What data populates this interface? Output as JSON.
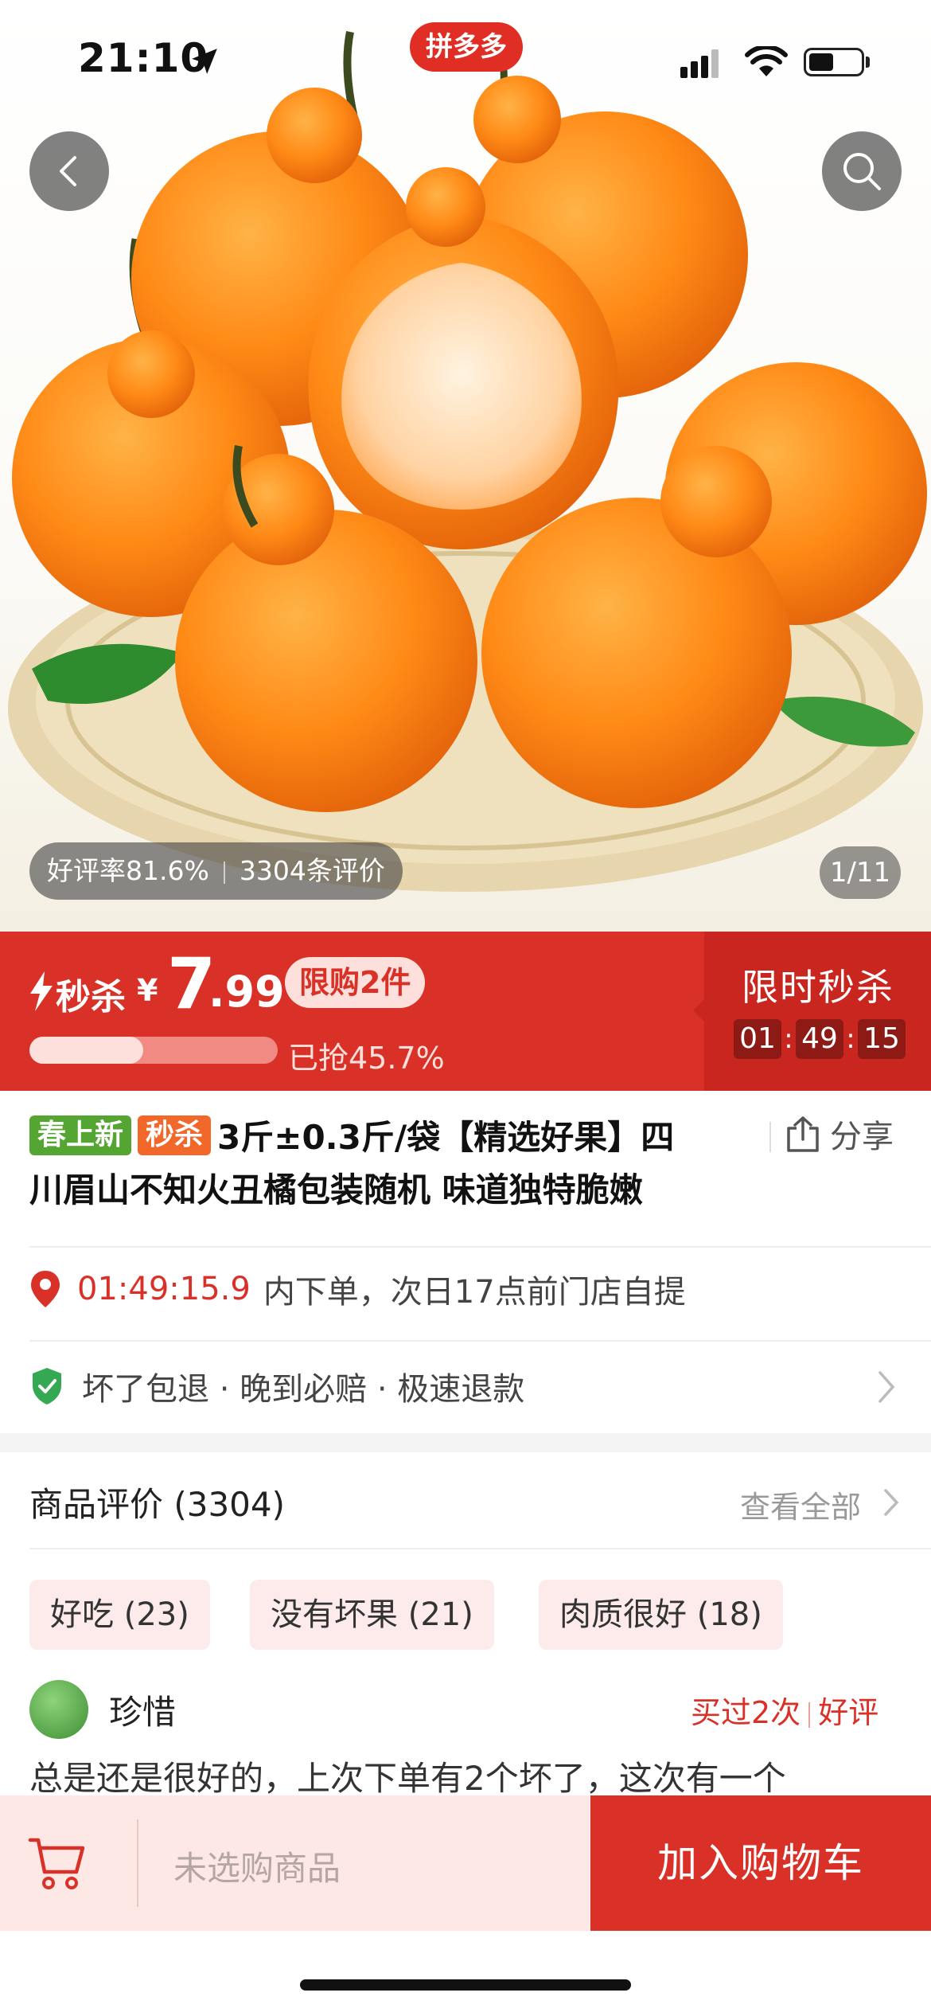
{
  "status_bar": {
    "time": "21:10",
    "app_badge": "拼多多"
  },
  "hero": {
    "rating_label": "好评率81.6%",
    "reviews_label": "3304条评价",
    "page_indicator": "1/11"
  },
  "price_banner": {
    "flash_label": "秒杀",
    "currency": "¥",
    "price_int": "7",
    "price_dec": ".99",
    "limit_tag": "限购2件",
    "sold_text": "已抢45.7%",
    "sold_fraction": 0.457,
    "flash_title": "限时秒杀",
    "countdown": {
      "h": "01",
      "m": "49",
      "s": "15"
    }
  },
  "product": {
    "tag1": "春上新",
    "tag2": "秒杀",
    "title_line1": "3斤±0.3斤/袋【精选好果】四",
    "title_line2": "川眉山不知火丑橘包装随机 味道独特脆嫩",
    "share_label": "分享"
  },
  "delivery": {
    "countdown": "01:49:15.9",
    "text": "内下单，次日17点前门店自提"
  },
  "service": {
    "text": "坏了包退 · 晚到必赔 · 极速退款"
  },
  "reviews": {
    "header": "商品评价 (3304)",
    "see_all": "查看全部",
    "chips": [
      "好吃 (23)",
      "没有坏果 (21)",
      "肉质很好 (18)"
    ],
    "first": {
      "name": "珍惜",
      "bought": "买过2次",
      "verdict": "好评",
      "text": "总是还是很好的，上次下单有2个坏了，这次有一个"
    }
  },
  "bottom_bar": {
    "empty_label": "未选购商品",
    "add_to_cart": "加入购物车"
  },
  "colors": {
    "brand_red": "#d93127",
    "tag_green": "#55a532",
    "tag_orange": "#f2682b"
  },
  "icons": [
    "back-arrow-icon",
    "search-icon",
    "lightning-icon",
    "share-icon",
    "location-pin-icon",
    "shield-check-icon",
    "chevron-right-icon",
    "cart-icon"
  ]
}
